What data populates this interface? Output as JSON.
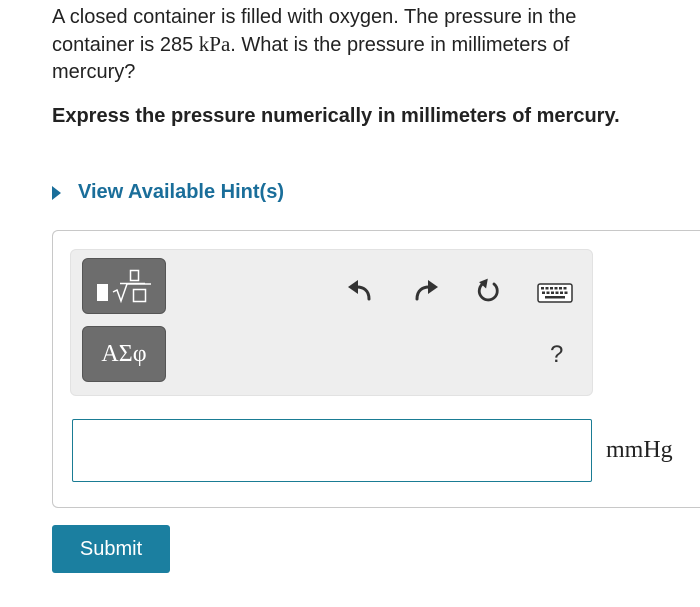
{
  "question": {
    "text_before": "A closed container is filled with oxygen. The pressure in the container is 285",
    "unit_math": "kPa",
    "text_after": ". What is the pressure in millimeters of mercury?"
  },
  "instruction": "Express the pressure numerically in millimeters of mercury.",
  "hint": {
    "label": "View Available Hint(s)"
  },
  "toolbar": {
    "template_icon": "fraction-sqrt-template-icon",
    "greek_label": "ΑΣφ",
    "undo_icon": "undo-arrow-icon",
    "redo_icon": "redo-arrow-icon",
    "reset_icon": "reset-icon",
    "keyboard_icon": "keyboard-icon",
    "help_label": "?"
  },
  "answer": {
    "value": "",
    "unit": "mmHg"
  },
  "submit_label": "Submit",
  "colors": {
    "accent": "#1b7fa0",
    "hint": "#1a6e9a",
    "toolbar_bg": "#eeeeee",
    "template_button": "#6d6d6d"
  }
}
